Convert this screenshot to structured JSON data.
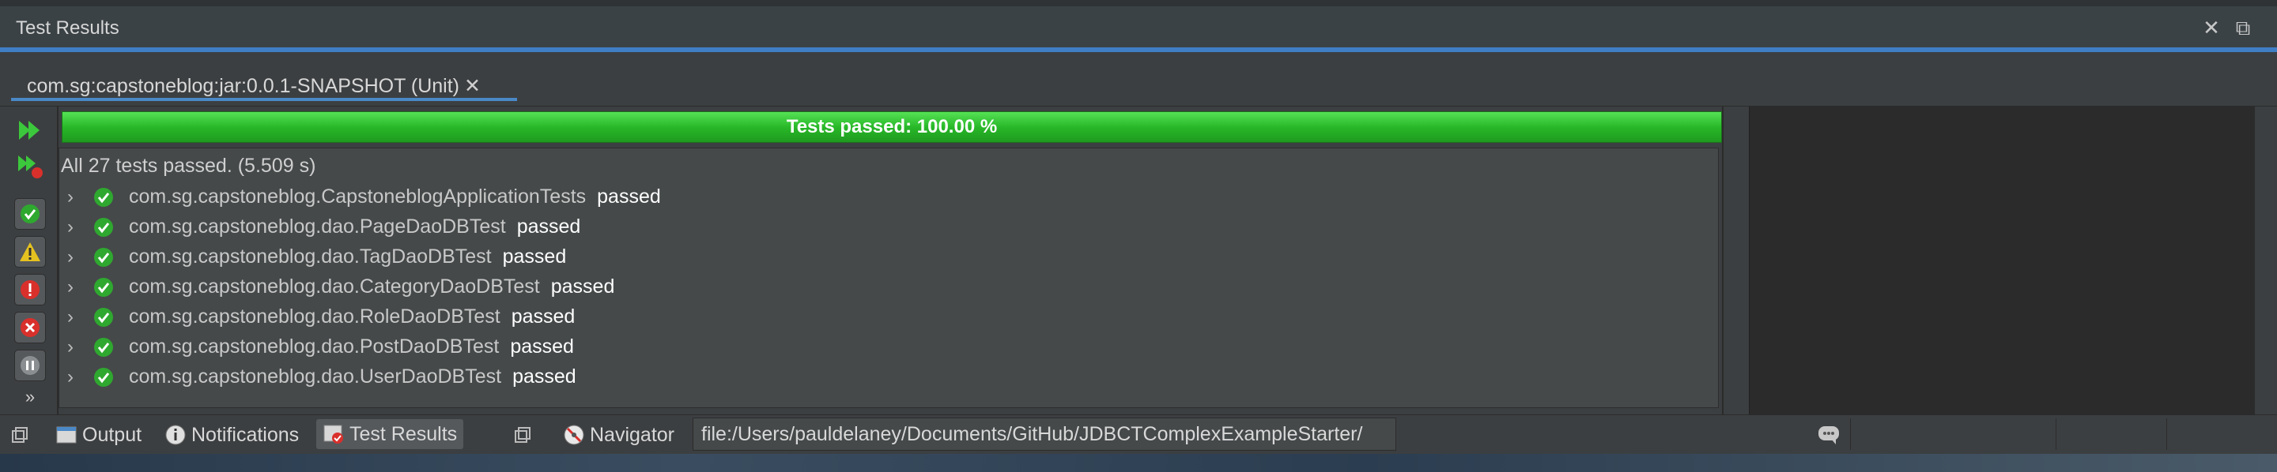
{
  "window": {
    "title": "Test Results",
    "close_label": "✕",
    "restore_label": "⧉"
  },
  "tab": {
    "label": "com.sg:capstoneblog:jar:0.0.1-SNAPSHOT (Unit)",
    "close": "✕"
  },
  "progress": {
    "label": "Tests passed: 100.00 %",
    "fraction": 1.0,
    "color": "#2cc22c"
  },
  "summary": "All 27 tests passed. (5.509 s)",
  "tests": [
    {
      "name": "com.sg.capstoneblog.CapstoneblogApplicationTests",
      "status": "passed"
    },
    {
      "name": "com.sg.capstoneblog.dao.PageDaoDBTest",
      "status": "passed"
    },
    {
      "name": "com.sg.capstoneblog.dao.TagDaoDBTest",
      "status": "passed"
    },
    {
      "name": "com.sg.capstoneblog.dao.CategoryDaoDBTest",
      "status": "passed"
    },
    {
      "name": "com.sg.capstoneblog.dao.RoleDaoDBTest",
      "status": "passed"
    },
    {
      "name": "com.sg.capstoneblog.dao.PostDaoDBTest",
      "status": "passed"
    },
    {
      "name": "com.sg.capstoneblog.dao.UserDaoDBTest",
      "status": "passed"
    }
  ],
  "statusbar": {
    "output": "Output",
    "notifications": "Notifications",
    "test_results": "Test Results",
    "navigator": "Navigator",
    "url": "file:/Users/pauldelaney/Documents/GitHub/JDBCTComplexExampleStarter/"
  },
  "colors": {
    "accent": "#3f7ec4",
    "pass_green": "#2cc22c",
    "warning": "#e5c220",
    "error": "#d9302c"
  },
  "icons": [
    "rerun-icon",
    "rerun-failed-icon",
    "show-passed-icon",
    "show-warnings-icon",
    "show-errors-icon",
    "show-aborted-icon",
    "show-ignored-icon",
    "more-icon",
    "expand-chevron-icon",
    "passed-check-icon",
    "info-icon",
    "navigator-icon",
    "chat-icon"
  ]
}
